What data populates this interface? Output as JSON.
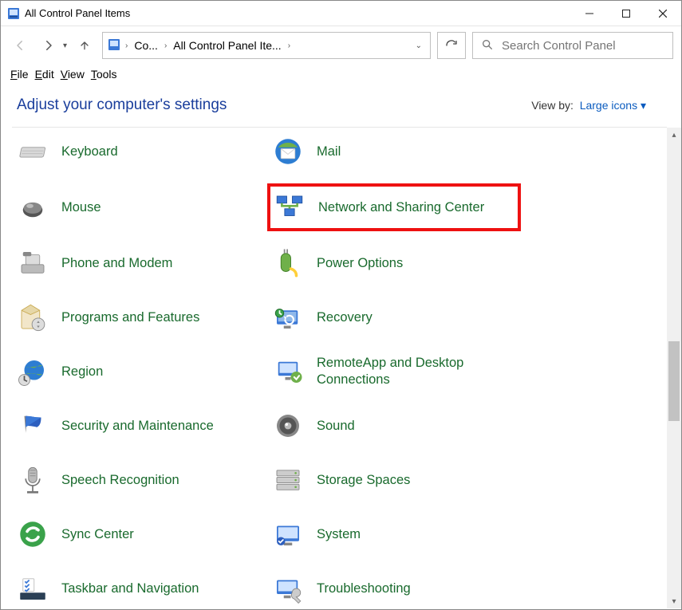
{
  "window": {
    "title": "All Control Panel Items"
  },
  "breadcrumbs": {
    "b1": "Co...",
    "b2": "All Control Panel Ite..."
  },
  "search": {
    "placeholder": "Search Control Panel"
  },
  "menu": {
    "file": "File",
    "edit": "Edit",
    "view": "View",
    "tools": "Tools"
  },
  "head": {
    "adjust": "Adjust your computer's settings",
    "viewby_label": "View by:",
    "viewby_mode": "Large icons"
  },
  "items": {
    "keyboard": "Keyboard",
    "mail": "Mail",
    "mouse": "Mouse",
    "network": "Network and Sharing Center",
    "phone": "Phone and Modem",
    "power": "Power Options",
    "programs": "Programs and Features",
    "recovery": "Recovery",
    "region": "Region",
    "remoteapp": "RemoteApp and Desktop Connections",
    "security": "Security and Maintenance",
    "sound": "Sound",
    "speech": "Speech Recognition",
    "storage": "Storage Spaces",
    "sync": "Sync Center",
    "system": "System",
    "taskbar": "Taskbar and Navigation",
    "troubleshooting": "Troubleshooting"
  }
}
